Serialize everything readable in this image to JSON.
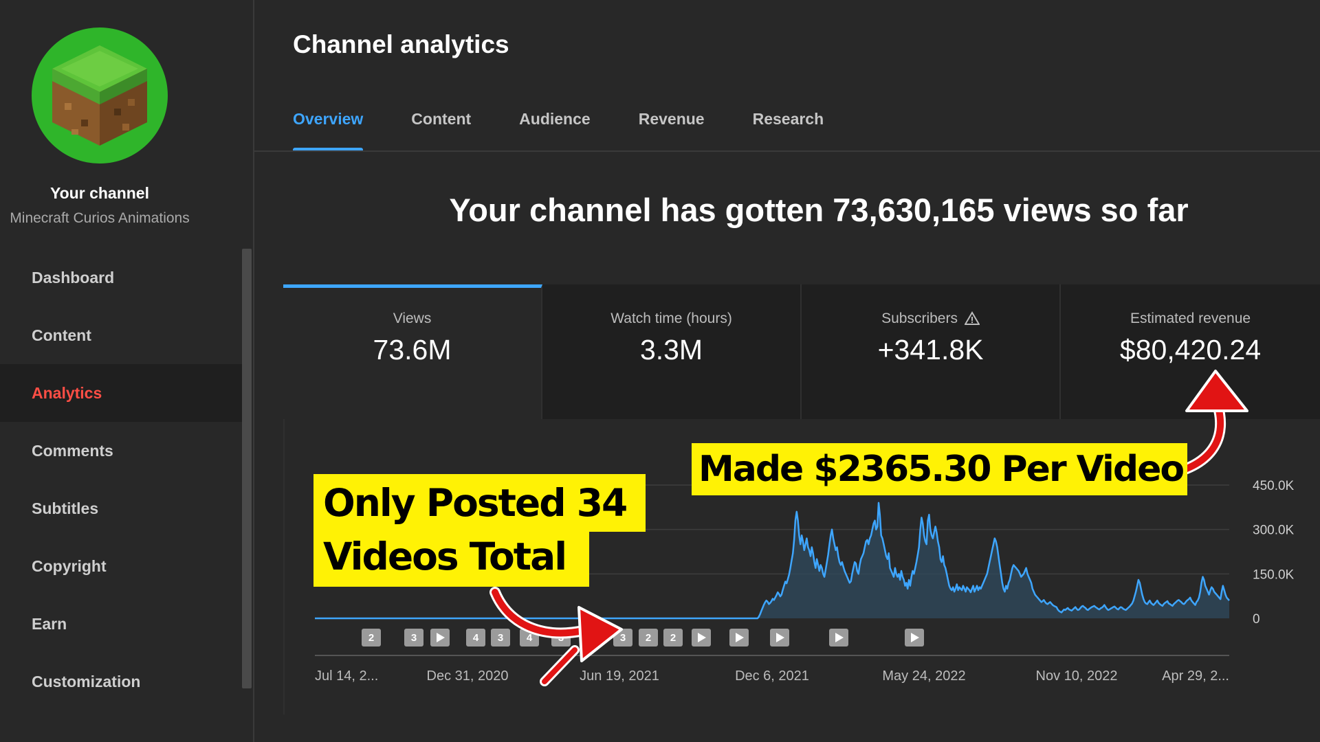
{
  "sidebar": {
    "channel_title": "Your channel",
    "channel_name": "Minecraft Curios Animations",
    "items": [
      {
        "label": "Dashboard",
        "active": false
      },
      {
        "label": "Content",
        "active": false
      },
      {
        "label": "Analytics",
        "active": true
      },
      {
        "label": "Comments",
        "active": false
      },
      {
        "label": "Subtitles",
        "active": false
      },
      {
        "label": "Copyright",
        "active": false
      },
      {
        "label": "Earn",
        "active": false
      },
      {
        "label": "Customization",
        "active": false
      }
    ]
  },
  "main": {
    "title": "Channel analytics",
    "tabs": [
      {
        "label": "Overview",
        "active": true
      },
      {
        "label": "Content",
        "active": false
      },
      {
        "label": "Audience",
        "active": false
      },
      {
        "label": "Revenue",
        "active": false
      },
      {
        "label": "Research",
        "active": false
      }
    ],
    "headline": "Your channel has gotten 73,630,165 views so far",
    "cards": [
      {
        "label": "Views",
        "value": "73.6M"
      },
      {
        "label": "Watch time (hours)",
        "value": "3.3M"
      },
      {
        "label": "Subscribers",
        "value": "+341.8K"
      },
      {
        "label": "Estimated revenue",
        "value": "$80,420.24"
      }
    ]
  },
  "callouts": {
    "revenue": "Made $2365.30 Per Video",
    "videos_line1": "Only Posted 34",
    "videos_line2": "Videos Total"
  },
  "colors": {
    "accent": "#3ea6ff",
    "active_nav": "#ff4e45",
    "callout_bg": "#fff205",
    "arrow": "#e11414"
  },
  "chart_data": {
    "type": "area",
    "series": [
      {
        "values": [
          0,
          0,
          0,
          0,
          0,
          0,
          0,
          0,
          0,
          0,
          0,
          0,
          0,
          0,
          0,
          0,
          0,
          0,
          0,
          0,
          0,
          0,
          0,
          0,
          0,
          0,
          0,
          0,
          0,
          0,
          0,
          0,
          0,
          0,
          0,
          0,
          0,
          0,
          0,
          0,
          0,
          0,
          0,
          0,
          0,
          0,
          0,
          0,
          0,
          0,
          0,
          0,
          0,
          0,
          0,
          0,
          0,
          0,
          0,
          0,
          0,
          0,
          0,
          0,
          0,
          0,
          0,
          0,
          0,
          0,
          0,
          0,
          0,
          0,
          0,
          0,
          0,
          0,
          0,
          0,
          0,
          0,
          0,
          0,
          0,
          0,
          0,
          0,
          0,
          0,
          0,
          0,
          0,
          0,
          0,
          0,
          0,
          0,
          0,
          0,
          0,
          0,
          0,
          0,
          0,
          0,
          0,
          0,
          0,
          0,
          0,
          0,
          0,
          0,
          0,
          0,
          0,
          0,
          0,
          0,
          0,
          0,
          0,
          0,
          0,
          0,
          0,
          0,
          0,
          0,
          0,
          0,
          0,
          0,
          0,
          0,
          0,
          0,
          0,
          0,
          0,
          0,
          0,
          0,
          0,
          0,
          0,
          0,
          0,
          0,
          0,
          0,
          0,
          0,
          0,
          0,
          0,
          0,
          0,
          0,
          0,
          0,
          0,
          0,
          0,
          0,
          0,
          0,
          0,
          0,
          0,
          0,
          0,
          0,
          0,
          0,
          0,
          0,
          0,
          0,
          0,
          0,
          0,
          0,
          0,
          0,
          0,
          0,
          0,
          0,
          0,
          0,
          0,
          0,
          0,
          0,
          0,
          0,
          0,
          0,
          0,
          0,
          0,
          0,
          0,
          0,
          0,
          0,
          0,
          0,
          0,
          0,
          0,
          0,
          0,
          0,
          0,
          0,
          0,
          0,
          0,
          0,
          0,
          0,
          0,
          0,
          0,
          0,
          0,
          0,
          0,
          0,
          0,
          0,
          0,
          0,
          0,
          0,
          0,
          0,
          0,
          0,
          0,
          0,
          0,
          0,
          0,
          0,
          0,
          0,
          0,
          0,
          0,
          0,
          0,
          0,
          0,
          0,
          0,
          0,
          0,
          0,
          0,
          0,
          0,
          0,
          0,
          0,
          0,
          0,
          0,
          0,
          0,
          0,
          0,
          0,
          0,
          0,
          0,
          0,
          0,
          0,
          0,
          0,
          0,
          0,
          0,
          0,
          0,
          0,
          0,
          0,
          0,
          0,
          0,
          0,
          0,
          0,
          0,
          0,
          0,
          0,
          0,
          0,
          0,
          0,
          0,
          0,
          0,
          0,
          0,
          0,
          0,
          0,
          0,
          0,
          0,
          0,
          0,
          0,
          0,
          0,
          0,
          0,
          0,
          0,
          0,
          0,
          0,
          0,
          0,
          0,
          0,
          0,
          0,
          0,
          0,
          0,
          0,
          0,
          0,
          0,
          0,
          0,
          0,
          0,
          0,
          0,
          0,
          0,
          0,
          0,
          5,
          14,
          25,
          35,
          46,
          54,
          60,
          56,
          48,
          52,
          58,
          66,
          62,
          70,
          78,
          88,
          82,
          74,
          80,
          96,
          110,
          124,
          118,
          132,
          148,
          170,
          195,
          220,
          265,
          330,
          360,
          330,
          280,
          250,
          280,
          260,
          230,
          250,
          270,
          240,
          230,
          210,
          240,
          220,
          190,
          170,
          200,
          180,
          160,
          180,
          170,
          150,
          140,
          165,
          190,
          215,
          250,
          280,
          300,
          270,
          250,
          230,
          240,
          210,
          190,
          180,
          190,
          175,
          160,
          150,
          140,
          130,
          120,
          125,
          150,
          170,
          190,
          185,
          160,
          150,
          180,
          200,
          210,
          220,
          240,
          260,
          265,
          250,
          270,
          280,
          300,
          320,
          330,
          300,
          310,
          390,
          350,
          280,
          270,
          250,
          230,
          210,
          200,
          220,
          170,
          160,
          150,
          140,
          170,
          150,
          140,
          150,
          130,
          160,
          140,
          130,
          110,
          120,
          100,
          130,
          110,
          140,
          160,
          150,
          170,
          190,
          215,
          240,
          300,
          340,
          320,
          280,
          260,
          250,
          330,
          350,
          300,
          280,
          270,
          290,
          310,
          290,
          260,
          240,
          200,
          190,
          210,
          180,
          170,
          150,
          130,
          110,
          100,
          95,
          105,
          90,
          100,
          115,
          95,
          105,
          100,
          95,
          110,
          100,
          90,
          105,
          100,
          95,
          88,
          100,
          110,
          90,
          100,
          110,
          95,
          105,
          100,
          110,
          120,
          130,
          140,
          150,
          170,
          190,
          210,
          230,
          250,
          270,
          260,
          240,
          210,
          180,
          150,
          120,
          100,
          90,
          110,
          100,
          120,
          130,
          150,
          170,
          180,
          175,
          170,
          165,
          160,
          150,
          140,
          145,
          150,
          160,
          170,
          150,
          140,
          130,
          120,
          100,
          90,
          80,
          75,
          70,
          65,
          60,
          55,
          58,
          62,
          55,
          50,
          48,
          52,
          55,
          50,
          45,
          42,
          40,
          38,
          30,
          25,
          22,
          20,
          25,
          30,
          28,
          32,
          35,
          30,
          28,
          26,
          30,
          34,
          38,
          32,
          28,
          30,
          35,
          40,
          42,
          38,
          35,
          30,
          28,
          32,
          35,
          38,
          40,
          42,
          38,
          35,
          32,
          30,
          34,
          36,
          40,
          45,
          38,
          32,
          28,
          30,
          33,
          35,
          38,
          40,
          36,
          32,
          30,
          35,
          38,
          36,
          32,
          30,
          28,
          32,
          36,
          40,
          45,
          50,
          60,
          75,
          90,
          110,
          130,
          120,
          100,
          80,
          65,
          55,
          50,
          48,
          55,
          60,
          52,
          48,
          45,
          50,
          55,
          60,
          52,
          48,
          45,
          42,
          48,
          52,
          55,
          58,
          50,
          48,
          45,
          42,
          48,
          52,
          56,
          60,
          62,
          58,
          55,
          50,
          48,
          52,
          58,
          62,
          65,
          70,
          60,
          55,
          50,
          45,
          55,
          60,
          70,
          90,
          120,
          140,
          130,
          110,
          100,
          90,
          80,
          95,
          105,
          100,
          90,
          85,
          80,
          75,
          70,
          65,
          90,
          110,
          95,
          80,
          70,
          65,
          60
        ]
      }
    ],
    "x_labels": [
      "Jul 14, 2...",
      "Dec 31, 2020",
      "Jun 19, 2021",
      "Dec 6, 2021",
      "May 24, 2022",
      "Nov 10, 2022",
      "Apr 29, 2..."
    ],
    "y_ticks": [
      "450.0K",
      "300.0K",
      "150.0K",
      "0"
    ],
    "ylim": [
      0,
      450000
    ],
    "grid": true,
    "markers": [
      "2",
      "3",
      "play",
      "4",
      "3",
      "4",
      "3",
      "2",
      "3",
      "2",
      "2",
      "play",
      "play",
      "play",
      "play",
      "play"
    ]
  }
}
